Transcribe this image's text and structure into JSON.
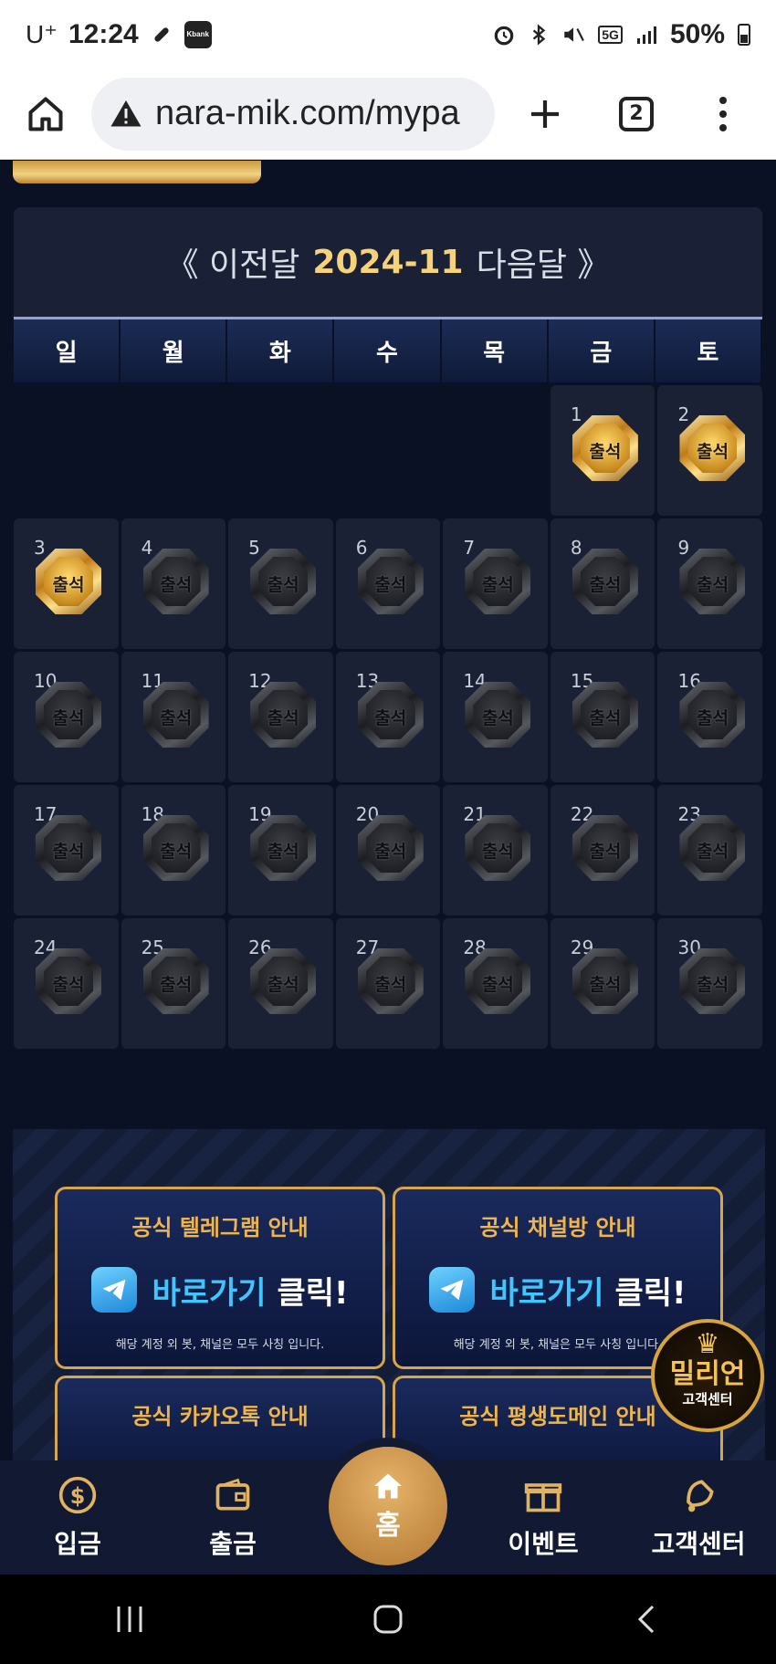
{
  "status_bar": {
    "carrier": "U⁺",
    "time": "12:24",
    "network": "5G",
    "battery": "50%"
  },
  "browser": {
    "url": "nara-mik.com/mypa",
    "tab_count": "2"
  },
  "calendar": {
    "prev_label": "《 이전달",
    "month": "2024-11",
    "next_label": "다음달 》",
    "weekdays": [
      "일",
      "월",
      "화",
      "수",
      "목",
      "금",
      "토"
    ],
    "badge_label": "출석",
    "leading_blanks": 5,
    "days_in_month": 30,
    "attended_days": [
      1,
      2,
      3
    ]
  },
  "promos": [
    {
      "title": "공식 텔레그램 안내",
      "cta_blue": "바로가기",
      "cta_white": "클릭!",
      "note": "해당 계정 외 봇, 채널은 모두 사칭 입니다."
    },
    {
      "title": "공식 채널방 안내",
      "cta_blue": "바로가기",
      "cta_white": "클릭!",
      "note": "해당 계정 외 봇, 채널은 모두 사칭 입니다."
    },
    {
      "title": "공식 카카오톡 안내"
    },
    {
      "title": "공식 평생도메인 안내"
    }
  ],
  "support_badge": {
    "brand": "밀리언",
    "sub": "고객센터"
  },
  "bottom_nav": {
    "deposit": "입금",
    "withdraw": "출금",
    "home": "홈",
    "event": "이벤트",
    "support": "고객센터"
  },
  "colors": {
    "accent_gold": "#f6d27a",
    "background": "#0b1124",
    "cell": "#1b2135"
  }
}
